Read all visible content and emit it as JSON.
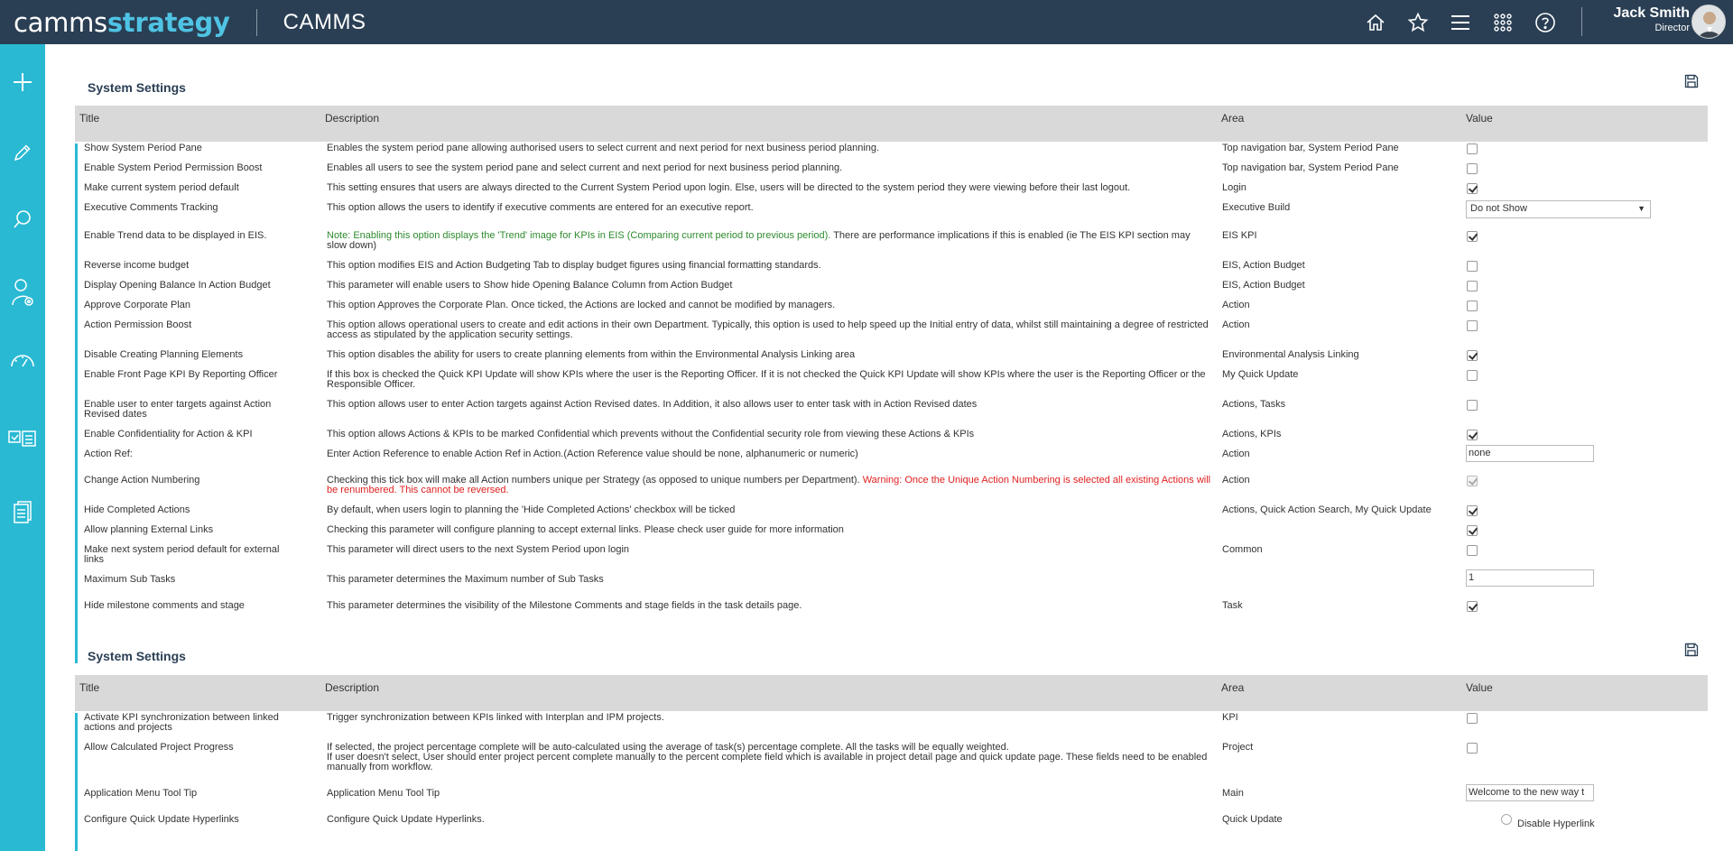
{
  "header": {
    "logo_part1": "camms",
    "logo_part2": "strategy",
    "app_name": "CAMMS",
    "user_name": "Jack Smith",
    "user_role": "Director"
  },
  "colors": {
    "topbar": "#2a3f54",
    "sidebar": "#29b9d3",
    "accent": "#4fc3e4",
    "warning": "#e02020",
    "note": "#2e8b2e"
  },
  "top_icons": [
    "home-icon",
    "star-icon",
    "menu-icon",
    "apps-grid-icon",
    "help-icon"
  ],
  "sidebar_icons": [
    "plus-icon",
    "pencil-icon",
    "search-icon",
    "user-settings-icon",
    "gauge-icon",
    "id-card-icon",
    "document-icon"
  ],
  "panel1": {
    "title": "System Settings",
    "columns": [
      "Title",
      "Description",
      "Area",
      "Value"
    ],
    "rows": [
      {
        "title": "Show System Period Pane",
        "desc": "Enables the system period pane allowing authorised users to select current and next period for next business period planning.",
        "area": "Top navigation bar, System Period Pane",
        "value_type": "checkbox",
        "checked": false
      },
      {
        "title": "Enable System Period Permission Boost",
        "desc": "Enables all users to see the system period pane and select current and next period for next business period planning.",
        "area": "Top navigation bar, System Period Pane",
        "value_type": "checkbox",
        "checked": false
      },
      {
        "title": "Make current system period default",
        "desc": "This setting ensures that users are always directed to the Current System Period upon login. Else, users will be directed to the system period they were viewing before their last logout.",
        "area": "Login",
        "value_type": "checkbox",
        "checked": true
      },
      {
        "title": "Executive Comments Tracking",
        "desc": "This option allows the users to identify if executive comments are entered for an executive report.",
        "area": "Executive Build",
        "value_type": "select",
        "value": "Do not Show"
      },
      {
        "title": "Enable Trend data to be displayed in EIS.",
        "desc_green": "Note: Enabling this option displays the 'Trend' image for KPIs in EIS (Comparing current period to previous period).",
        "desc": " There are performance implications if this is enabled (ie The EIS KPI section may slow down)",
        "area": "EIS KPI",
        "value_type": "checkbox",
        "checked": true
      },
      {
        "title": "Reverse income budget",
        "desc": "This option modifies EIS and Action Budgeting Tab to display budget figures using financial formatting standards.",
        "area": "EIS, Action Budget",
        "value_type": "checkbox",
        "checked": false
      },
      {
        "title": "Display Opening Balance In Action Budget",
        "desc": "This parameter will enable users to Show hide Opening Balance Column from Action Budget",
        "area": "EIS, Action Budget",
        "value_type": "checkbox",
        "checked": false
      },
      {
        "title": "Approve Corporate Plan",
        "desc": "This option Approves the Corporate Plan. Once ticked, the Actions are locked and cannot be modified by managers.",
        "area": "Action",
        "value_type": "checkbox",
        "checked": false
      },
      {
        "title": "Action Permission Boost",
        "desc": "This option allows operational users to create and edit actions in their own Department. Typically, this option is used to help speed up the Initial entry of data, whilst still maintaining a degree of restricted access as stipulated by the application security settings.",
        "area": "Action",
        "value_type": "checkbox",
        "checked": false
      },
      {
        "title": "Disable Creating Planning Elements",
        "desc": "This option disables the ability for users to create planning elements from within the Environmental Analysis Linking area",
        "area": "Environmental Analysis Linking",
        "value_type": "checkbox",
        "checked": true
      },
      {
        "title": "Enable Front Page KPI By Reporting Officer",
        "desc": "If this box is checked the Quick KPI Update will show KPIs where the user is the Reporting Officer. If it is not checked the Quick KPI Update will show KPIs where the user is the Reporting Officer or the Responsible Officer.",
        "area": "My Quick Update",
        "value_type": "checkbox",
        "checked": false
      },
      {
        "title": "Enable user to enter targets against Action Revised dates",
        "desc": "This option allows user to enter Action targets against Action Revised dates. In Addition, it also allows user to enter task with in Action Revised dates",
        "area": "Actions, Tasks",
        "value_type": "checkbox",
        "checked": false
      },
      {
        "title": "Enable Confidentiality for Action & KPI",
        "desc": "This option allows Actions & KPIs to be marked Confidential which prevents without the Confidential security role from viewing these Actions & KPIs",
        "area": "Actions, KPIs",
        "value_type": "checkbox",
        "checked": true
      },
      {
        "title": "Action Ref:",
        "desc": "Enter Action Reference to enable Action Ref in Action.(Action Reference value should be none, alphanumeric or numeric)",
        "area": "Action",
        "value_type": "text",
        "value": "none"
      },
      {
        "title": "Change Action Numbering",
        "desc": "Checking this tick box will make all Action numbers unique per Strategy (as opposed to unique numbers per Department). ",
        "desc_red": "Warning: Once the Unique Action Numbering is selected all existing Actions will be renumbered. This cannot be reversed.",
        "area": "Action",
        "value_type": "checkbox_disabled",
        "checked": true
      },
      {
        "title": "Hide Completed Actions",
        "desc": "By default, when users login to planning the 'Hide Completed Actions' checkbox will be ticked",
        "area": "Actions, Quick Action Search, My Quick Update",
        "value_type": "checkbox",
        "checked": true
      },
      {
        "title": "Allow planning External Links",
        "desc": "Checking this parameter will configure planning to accept external links. Please check user guide for more information",
        "area": "",
        "value_type": "checkbox",
        "checked": true
      },
      {
        "title": "Make next system period default for external links",
        "desc": "This parameter will direct users to the next System Period upon login",
        "area": "Common",
        "value_type": "checkbox",
        "checked": false
      },
      {
        "title": "Maximum Sub Tasks",
        "desc": "This parameter determines the Maximum number of Sub Tasks",
        "area": "",
        "value_type": "text",
        "value": "1"
      },
      {
        "title": "Hide milestone comments and stage",
        "desc": "This parameter determines the visibility of the Milestone Comments and stage fields in the task details page.",
        "area": "Task",
        "value_type": "checkbox",
        "checked": true
      }
    ]
  },
  "panel2": {
    "title": "System Settings",
    "columns": [
      "Title",
      "Description",
      "Area",
      "Value"
    ],
    "rows": [
      {
        "title": "Activate KPI synchronization between linked actions and projects",
        "desc": "Trigger synchronization between KPIs linked with Interplan and IPM projects.",
        "area": "KPI",
        "value_type": "checkbox",
        "checked": false
      },
      {
        "title": "Allow Calculated Project Progress",
        "desc": "If selected, the project percentage complete will be auto-calculated using the average of task(s) percentage complete. All the tasks will be equally weighted.",
        "desc2": "If user doesn't select, User should enter project percent complete manually to the percent complete field which is available in project detail page and quick update page. These fields need to be enabled manually from workflow.",
        "area": "Project",
        "value_type": "checkbox",
        "checked": false
      },
      {
        "title": "Application Menu Tool Tip",
        "desc": "Application Menu Tool Tip",
        "area": "Main",
        "value_type": "text",
        "value": "Welcome to the new way t"
      },
      {
        "title": "Configure Quick Update Hyperlinks",
        "desc": "Configure Quick Update Hyperlinks.",
        "area": "Quick Update",
        "value_type": "radio",
        "value": "Disable Hyperlink"
      }
    ]
  }
}
